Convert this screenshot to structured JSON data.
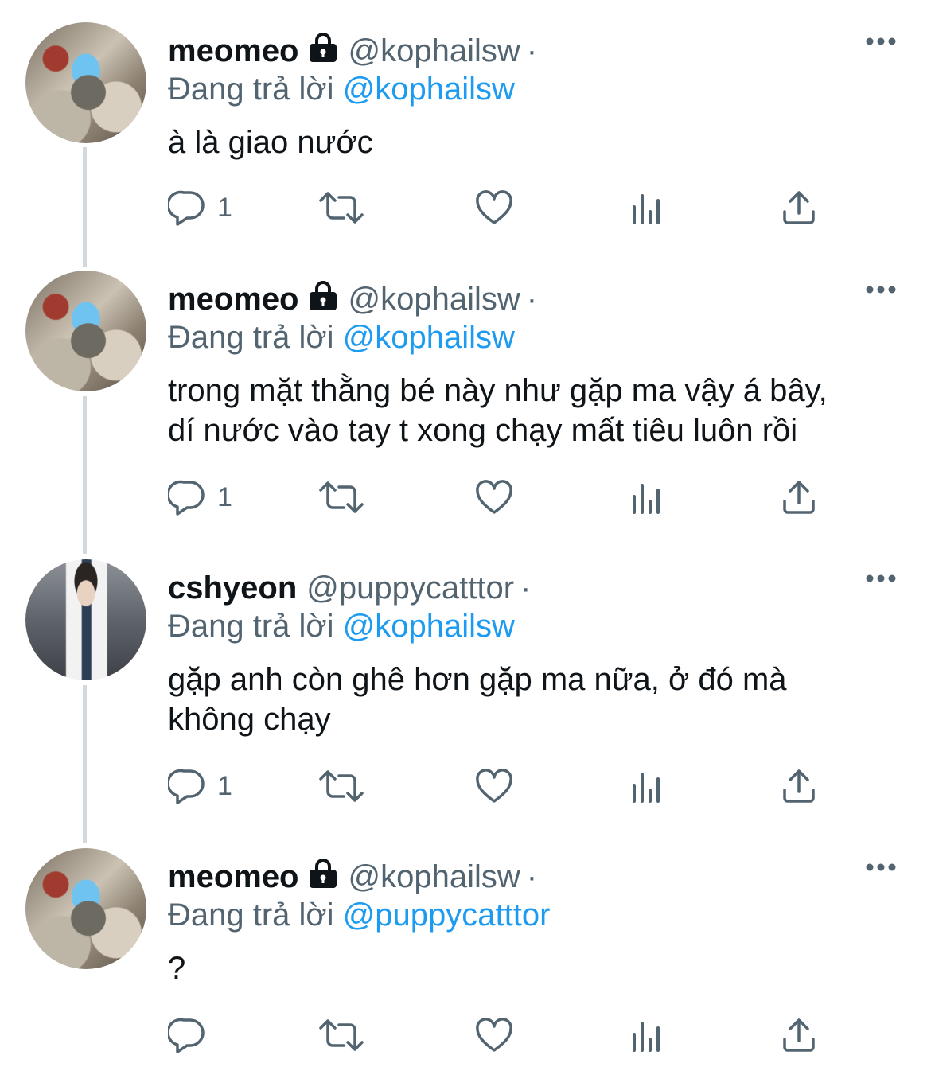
{
  "tweets": [
    {
      "name": "meomeo",
      "handle": "@kophailsw",
      "dot": "·",
      "replying_label": "Đang trả lời",
      "replying_to": "@kophailsw",
      "lines": [
        "à là giao nước"
      ],
      "reply_count": "1",
      "avatar": "cat-avatar",
      "locked": true
    },
    {
      "name": "meomeo",
      "handle": "@kophailsw",
      "dot": "·",
      "replying_label": "Đang trả lời",
      "replying_to": "@kophailsw",
      "lines": [
        "trong mặt thằng bé này như gặp ma vậy á bây,",
        "dí nước vào tay t xong chạy mất tiêu luôn rồi"
      ],
      "reply_count": "1",
      "avatar": "cat-avatar",
      "locked": true
    },
    {
      "name": "cshyeon",
      "handle": "@puppycatttor",
      "dot": "·",
      "replying_label": "Đang trả lời",
      "replying_to": "@kophailsw",
      "lines": [
        "gặp anh còn ghê hơn gặp ma nữa, ở đó mà",
        "không chạy"
      ],
      "reply_count": "1",
      "avatar": "doctor-avatar",
      "locked": false
    },
    {
      "name": "meomeo",
      "handle": "@kophailsw",
      "dot": "·",
      "replying_label": "Đang trả lời",
      "replying_to": "@puppycatttor",
      "lines": [
        "?"
      ],
      "reply_count": "",
      "avatar": "cat-avatar",
      "locked": true
    }
  ],
  "icons": {
    "reply": "reply-icon",
    "retweet": "retweet-icon",
    "like": "heart-icon",
    "views": "views-icon",
    "share": "share-icon",
    "more": "more-icon",
    "lock": "lock-icon"
  },
  "colors": {
    "link": "#1d9bf0",
    "secondary": "#536471",
    "thread_line": "#cfd9de"
  }
}
